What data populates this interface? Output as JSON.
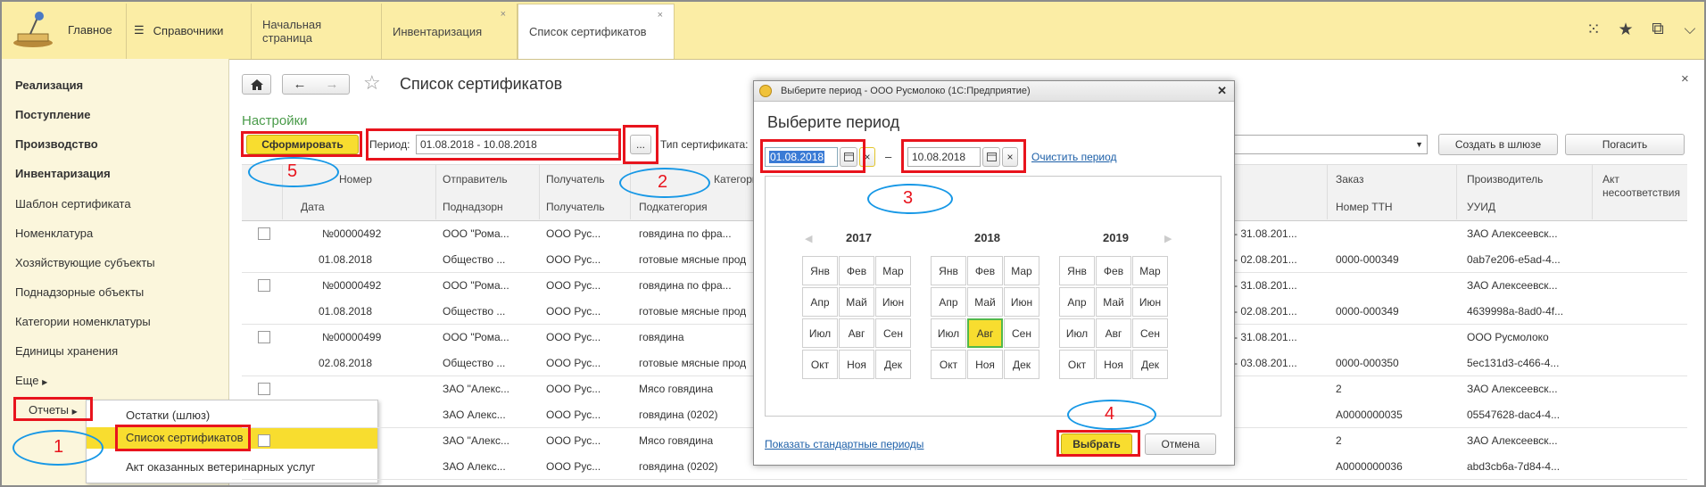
{
  "tabs": {
    "home": "Главное",
    "catalogs": "Справочники",
    "start": "Начальная страница",
    "inventory": "Инвентаризация",
    "certs": "Список сертификатов",
    "close": "×"
  },
  "sidebar": {
    "items": [
      "Реализация",
      "Поступление",
      "Производство",
      "Инвентаризация",
      "Шаблон сертификата",
      "Номенклатура",
      "Хозяйствующие субъекты",
      "Поднадзорные объекты",
      "Категории номенклатуры",
      "Единицы хранения",
      "Еще"
    ],
    "reports": "Отчеты"
  },
  "popup": [
    "Остатки (шлюз)",
    "Список сертификатов",
    "Акт оказанных ветеринарных услуг"
  ],
  "main": {
    "title": "Список сертификатов",
    "settings": "Настройки",
    "form_button": "Сформировать",
    "period_label": "Период:",
    "period_value": "01.08.2018 - 10.08.2018",
    "ellipsis": "...",
    "cert_type_label": "Тип сертификата:",
    "create_gateway": "Создать в шлюзе",
    "repay": "Погасить",
    "close": "×"
  },
  "table": {
    "headers_top": [
      "Номер",
      "Отправитель",
      "Получатель",
      "Категорий",
      "Заказ",
      "Производитель",
      "Акт несоответствия"
    ],
    "headers_bottom": [
      "Дата",
      "Поднадзорн",
      "Получатель",
      "Подкатегория",
      "Номер ТТН",
      "УУИД"
    ],
    "rows": [
      [
        "№00000492",
        "ООО \"Рома...",
        "ООО Рус...",
        "говядина по фра...",
        "- 31.08.201...",
        "",
        "ЗАО Алексеевск..."
      ],
      [
        "01.08.2018",
        "Общество ...",
        "ООО Рус...",
        "готовые мясные прод",
        "- 02.08.201...",
        "0000-000349",
        "0ab7e206-e5ad-4..."
      ],
      [
        "№00000492",
        "ООО \"Рома...",
        "ООО Рус...",
        "говядина по фра...",
        "- 31.08.201...",
        "",
        "ЗАО Алексеевск..."
      ],
      [
        "01.08.2018",
        "Общество ...",
        "ООО Рус...",
        "готовые мясные прод",
        "- 02.08.201...",
        "0000-000349",
        "4639998a-8ad0-4f..."
      ],
      [
        "№00000499",
        "ООО \"Рома...",
        "ООО Рус...",
        "говядина",
        "- 31.08.201...",
        "",
        "ООО Русмолоко"
      ],
      [
        "02.08.2018",
        "Общество ...",
        "ООО Рус...",
        "готовые мясные прод",
        "- 03.08.201...",
        "0000-000350",
        "5ec131d3-c466-4..."
      ],
      [
        "",
        "ЗАО \"Алекс...",
        "ООО Рус...",
        "Мясо говядина",
        "",
        "2",
        "ЗАО Алексеевск..."
      ],
      [
        "",
        "ЗАО Алекс...",
        "ООО Рус...",
        "говядина (0202)",
        "",
        "А0000000035",
        "05547628-dac4-4..."
      ],
      [
        "",
        "ЗАО \"Алекс...",
        "ООО Рус...",
        "Мясо говядина",
        "",
        "2",
        "ЗАО Алексеевск..."
      ],
      [
        "",
        "ЗАО Алекс...",
        "ООО Рус...",
        "говядина (0202)",
        "",
        "А0000000036",
        "abd3cb6a-7d84-4..."
      ]
    ]
  },
  "dialog": {
    "title": "Выберите период - ООО Русмолоко  (1С:Предприятие)",
    "heading": "Выберите период",
    "from": "01.08.2018",
    "to": "10.08.2018",
    "dash": "–",
    "clear": "Очистить период",
    "years": [
      "2017",
      "2018",
      "2019"
    ],
    "months": [
      "Янв",
      "Фев",
      "Мар",
      "Апр",
      "Май",
      "Июн",
      "Июл",
      "Авг",
      "Сен",
      "Окт",
      "Ноя",
      "Дек"
    ],
    "show_std": "Показать стандартные периоды",
    "select": "Выбрать",
    "cancel": "Отмена",
    "close": "✕"
  },
  "annotations": [
    "1",
    "2",
    "3",
    "4",
    "5"
  ]
}
